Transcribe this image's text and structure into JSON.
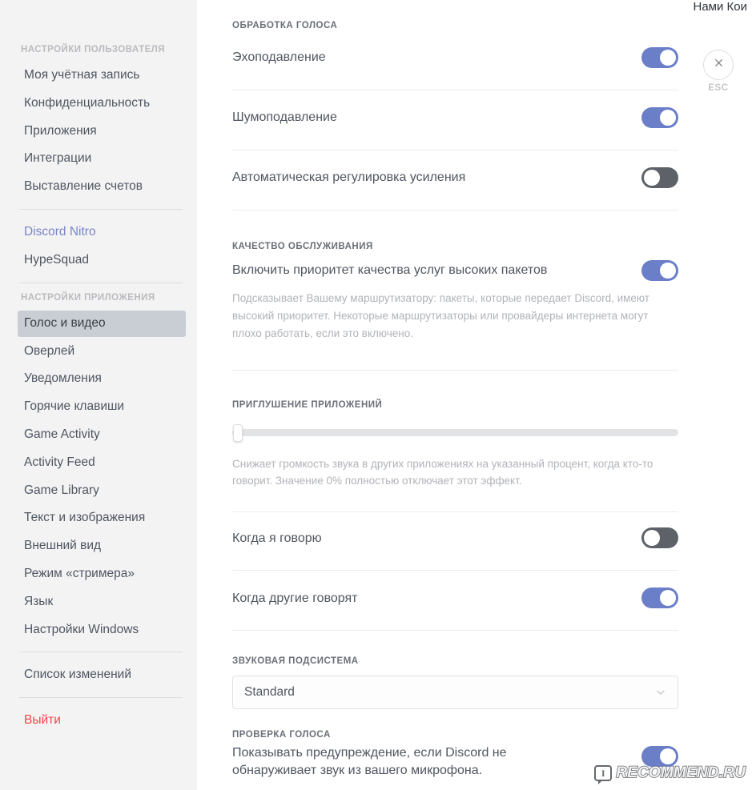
{
  "window": {
    "username": "Нами Кои",
    "close_label": "ESC",
    "close_icon": "close-icon"
  },
  "sidebar": {
    "user_settings_header": "НАСТРОЙКИ ПОЛЬЗОВАТЕЛЯ",
    "user_items": [
      {
        "label": "Моя учётная запись"
      },
      {
        "label": "Конфиденциальность"
      },
      {
        "label": "Приложения"
      },
      {
        "label": "Интеграции"
      },
      {
        "label": "Выставление счетов"
      }
    ],
    "promo_items": [
      {
        "label": "Discord Nitro",
        "style": "nitro"
      },
      {
        "label": "HypeSquad",
        "style": "normal"
      }
    ],
    "app_settings_header": "НАСТРОЙКИ ПРИЛОЖЕНИЯ",
    "app_items": [
      {
        "label": "Голос и видео",
        "selected": true
      },
      {
        "label": "Оверлей",
        "selected": false
      },
      {
        "label": "Уведомления",
        "selected": false
      },
      {
        "label": "Горячие клавиши",
        "selected": false
      },
      {
        "label": "Game Activity",
        "selected": false
      },
      {
        "label": "Activity Feed",
        "selected": false
      },
      {
        "label": "Game Library",
        "selected": false
      },
      {
        "label": "Текст и изображения",
        "selected": false
      },
      {
        "label": "Внешний вид",
        "selected": false
      },
      {
        "label": "Режим «стримера»",
        "selected": false
      },
      {
        "label": "Язык",
        "selected": false
      },
      {
        "label": "Настройки Windows",
        "selected": false
      }
    ],
    "changelog_label": "Список изменений",
    "logout_label": "Выйти"
  },
  "main": {
    "voice_processing": {
      "header": "ОБРАБОТКА ГОЛОСА",
      "rows": [
        {
          "label": "Эхоподавление",
          "state": "on"
        },
        {
          "label": "Шумоподавление",
          "state": "on"
        },
        {
          "label": "Автоматическая регулировка усиления",
          "state": "off"
        }
      ]
    },
    "qos": {
      "header": "КАЧЕСТВО ОБСЛУЖИВАНИЯ",
      "label": "Включить приоритет качества услуг высоких пакетов",
      "state": "on",
      "description": "Подсказывает Вашему маршрутизатору: пакеты, которые передает Discord, имеют высокий приоритет. Некоторые маршрутизаторы или провайдеры интернета могут плохо работать, если это включено."
    },
    "attenuation": {
      "header": "ПРИГЛУШЕНИЕ ПРИЛОЖЕНИЙ",
      "value_percent": 0,
      "description": "Снижает громкость звука в других приложениях на указанный процент, когда кто-то говорит. Значение 0% полностью отключает этот эффект.",
      "rows": [
        {
          "label": "Когда я говорю",
          "state": "off"
        },
        {
          "label": "Когда другие говорят",
          "state": "on"
        }
      ]
    },
    "audio_subsystem": {
      "header": "ЗВУКОВАЯ ПОДСИСТЕМА",
      "selected": "Standard",
      "chevron_icon": "chevron-down-icon"
    },
    "voice_check": {
      "header": "ПРОВЕРКА ГОЛОСА",
      "label": "Показывать предупреждение, если Discord не обнаруживает звук из вашего микрофона.",
      "state": "on"
    }
  },
  "watermark": {
    "badge": "I",
    "text": "RECOMMEND.RU"
  },
  "colors": {
    "toggle_on": "#6b7ec8",
    "toggle_off": "#5d6268",
    "nitro": "#7a84c9",
    "logout": "#f04747",
    "sidebar_bg": "#f3f3f4",
    "selected_bg": "#c9ced4"
  }
}
